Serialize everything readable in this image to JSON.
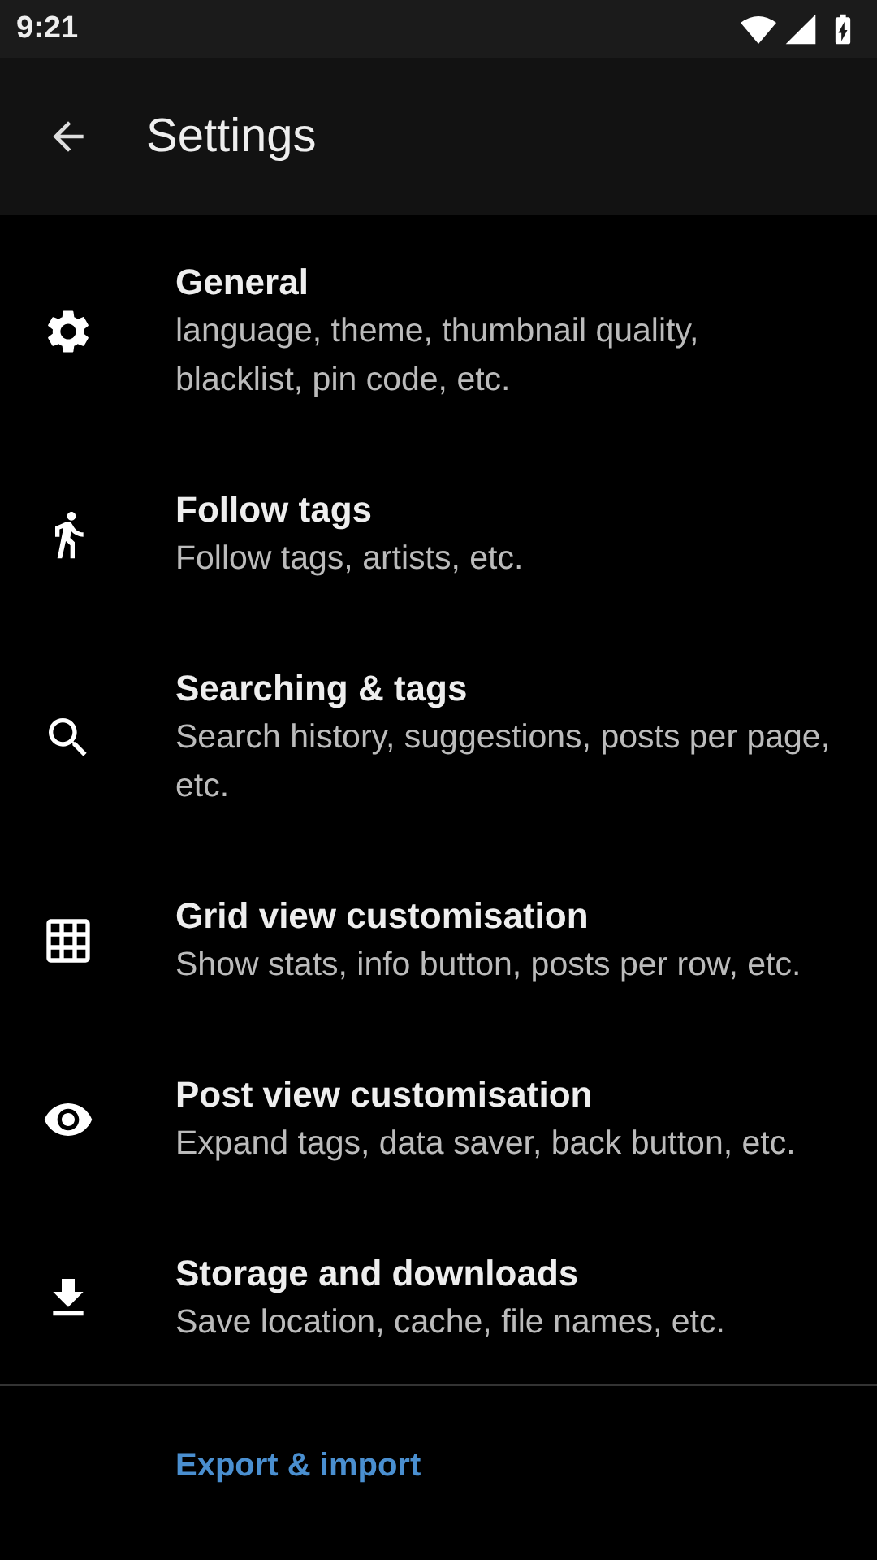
{
  "status_bar": {
    "time": "9:21"
  },
  "toolbar": {
    "title": "Settings"
  },
  "items": [
    {
      "title": "General",
      "subtitle": "language, theme, thumbnail quality, blacklist, pin code, etc."
    },
    {
      "title": "Follow tags",
      "subtitle": "Follow tags, artists, etc."
    },
    {
      "title": "Searching & tags",
      "subtitle": "Search history, suggestions, posts per page, etc."
    },
    {
      "title": "Grid view customisation",
      "subtitle": "Show stats, info button, posts per row, etc."
    },
    {
      "title": "Post view customisation",
      "subtitle": "Expand tags, data saver, back button, etc."
    },
    {
      "title": "Storage and downloads",
      "subtitle": "Save location, cache, file names, etc."
    }
  ],
  "footer_link": "Export & import"
}
